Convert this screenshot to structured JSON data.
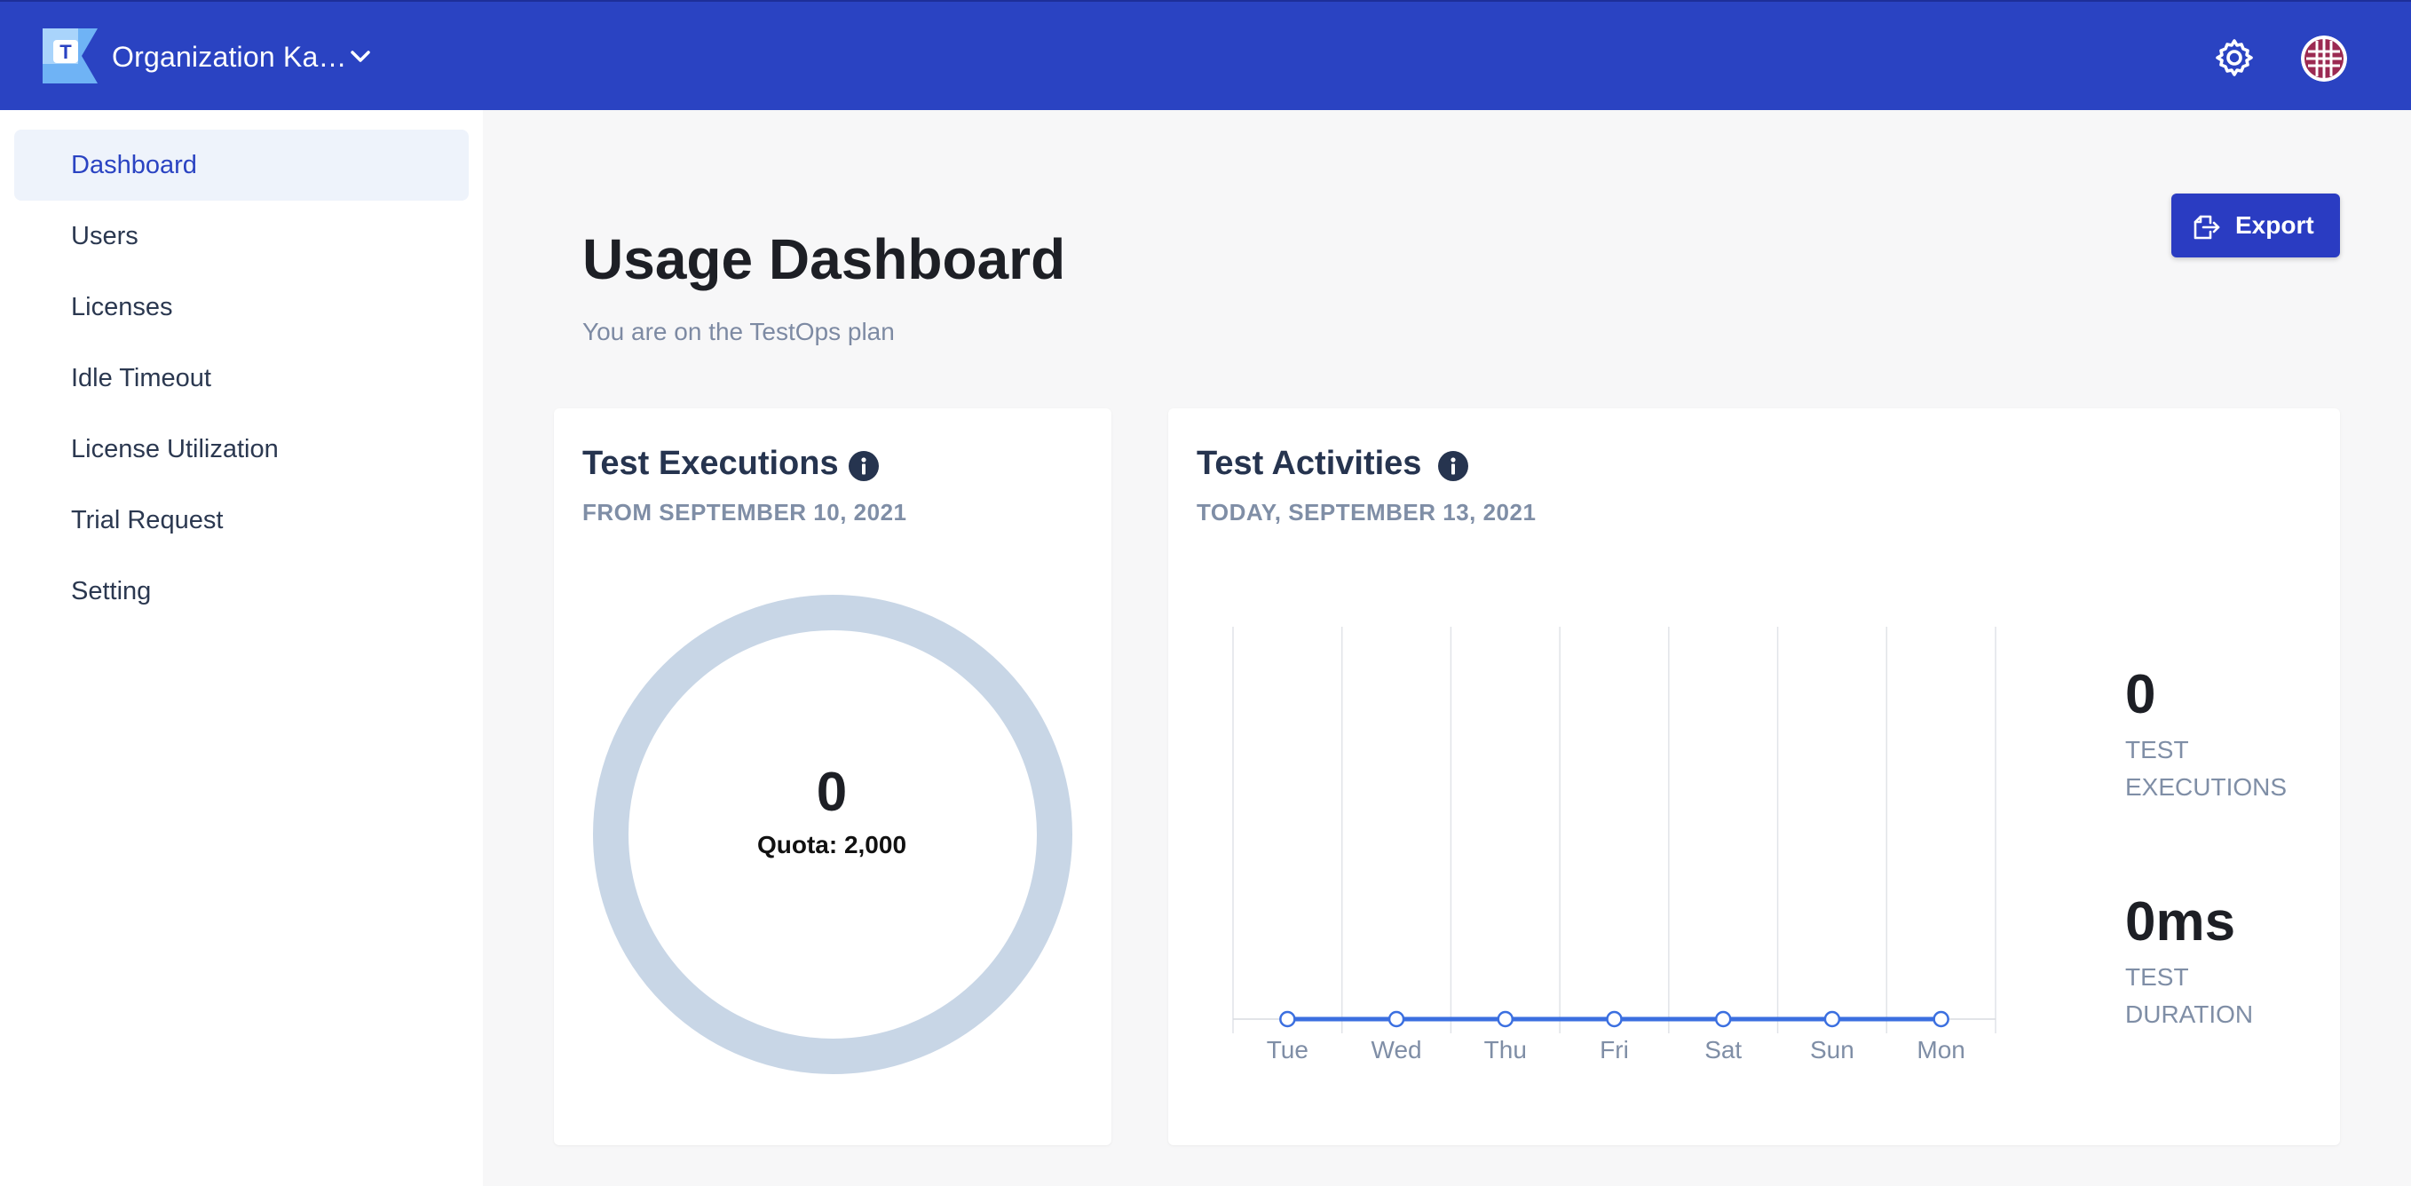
{
  "header": {
    "org_name": "Organization Ka…",
    "logo_letter": "T",
    "icons": [
      "gear-icon",
      "avatar-image",
      "chevron-down-icon"
    ]
  },
  "sidebar": {
    "items": [
      {
        "label": "Dashboard",
        "active": true
      },
      {
        "label": "Users",
        "active": false
      },
      {
        "label": "Licenses",
        "active": false
      },
      {
        "label": "Idle Timeout",
        "active": false
      },
      {
        "label": "License Utilization",
        "active": false
      },
      {
        "label": "Trial Request",
        "active": false
      },
      {
        "label": "Setting",
        "active": false
      }
    ]
  },
  "main": {
    "title": "Usage Dashboard",
    "subtitle": "You are on the TestOps plan",
    "export_label": "Export"
  },
  "executions_card": {
    "title": "Test Executions",
    "subtitle": "FROM SEPTEMBER 10, 2021",
    "value": "0",
    "quota": "Quota: 2,000"
  },
  "activities_card": {
    "title": "Test Activities",
    "subtitle": "TODAY, SEPTEMBER 13, 2021",
    "stats": [
      {
        "value": "0",
        "label": "TEST EXECUTIONS"
      },
      {
        "value": "0ms",
        "label": "TEST DURATION"
      }
    ]
  },
  "colors": {
    "header_bg": "#2a43c2",
    "accent": "#2a3cc2",
    "line": "#3b6fe0",
    "donut_track": "#c8d6e6"
  },
  "chart_data": {
    "type": "line",
    "categories": [
      "Tue",
      "Wed",
      "Thu",
      "Fri",
      "Sat",
      "Sun",
      "Mon"
    ],
    "values": [
      0,
      0,
      0,
      0,
      0,
      0,
      0
    ],
    "grid": true,
    "title": "",
    "xlabel": "",
    "ylabel": ""
  }
}
